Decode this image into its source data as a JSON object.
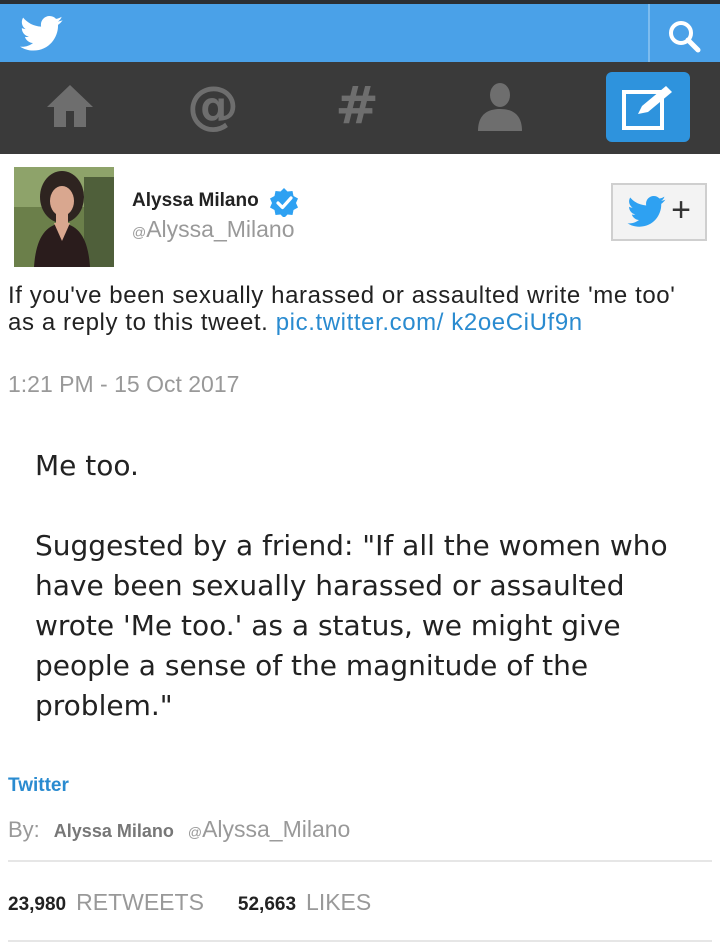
{
  "header": {
    "icons": {
      "logo": "twitter-bird-icon",
      "search": "search-icon"
    }
  },
  "nav": {
    "items": [
      {
        "name": "home-icon"
      },
      {
        "name": "mentions-icon",
        "glyph": "@"
      },
      {
        "name": "hashtag-icon",
        "glyph": "#"
      },
      {
        "name": "profile-icon"
      },
      {
        "name": "compose-icon"
      }
    ]
  },
  "tweet": {
    "author_name": "Alyssa Milano",
    "author_handle_at": "@",
    "author_handle": "Alyssa_Milano",
    "text": "If you've been sexually harassed or assaulted write 'me too' as a reply to this tweet.",
    "link": "pic.twitter.com/ k2oeCiUf9n",
    "timestamp": "1:21 PM - 15 Oct 2017",
    "image_text": {
      "line1": "Me too.",
      "line2": "Suggested by a friend: \"If all the women who have been sexually harassed or assaulted wrote 'Me too.' as a status, we might give people a sense of the magnitude of the problem.\""
    }
  },
  "footer": {
    "source": "Twitter",
    "by_label": "By:",
    "by_name": "Alyssa Milano",
    "by_handle_at": "@",
    "by_handle": "Alyssa_Milano",
    "retweets_count": "23,980",
    "retweets_label": "RETWEETS",
    "likes_count": "52,663",
    "likes_label": "LIKES"
  },
  "colors": {
    "topbar": "#4aa1e8",
    "navbar": "#3a3a3a",
    "compose": "#2e93dd",
    "link": "#2a8bd0",
    "muted": "#999999"
  }
}
